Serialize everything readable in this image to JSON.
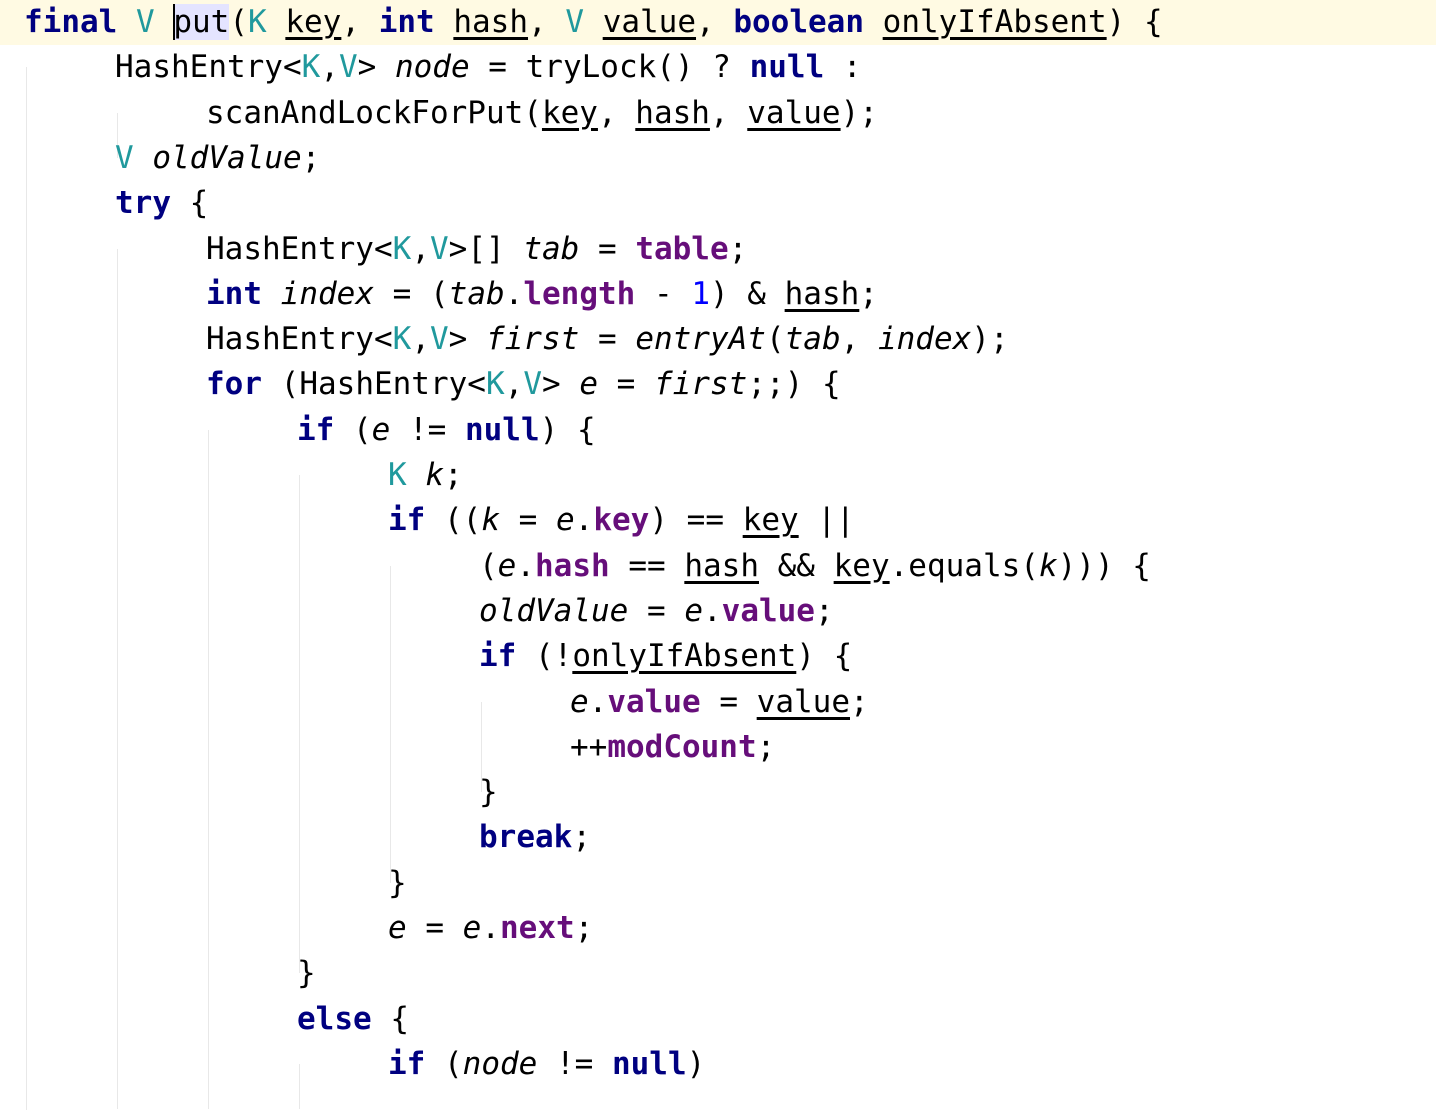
{
  "editor": {
    "language": "Java",
    "caret": {
      "line": 1,
      "before_token": "put"
    },
    "highlighted_identifier": "put",
    "lines": [
      {
        "n": 1,
        "indent": 0,
        "current": true,
        "tokens": [
          {
            "t": "final",
            "s": "kw"
          },
          {
            "t": " ",
            "s": "pl"
          },
          {
            "t": "V",
            "s": "tp"
          },
          {
            "t": " ",
            "s": "pl"
          },
          {
            "t": "put",
            "s": "fn",
            "hl": true,
            "caret": true
          },
          {
            "t": "(",
            "s": "pl"
          },
          {
            "t": "K",
            "s": "tp"
          },
          {
            "t": " ",
            "s": "pl"
          },
          {
            "t": "key",
            "s": "prm"
          },
          {
            "t": ", ",
            "s": "pl"
          },
          {
            "t": "int",
            "s": "kw"
          },
          {
            "t": " ",
            "s": "pl"
          },
          {
            "t": "hash",
            "s": "prm"
          },
          {
            "t": ", ",
            "s": "pl"
          },
          {
            "t": "V",
            "s": "tp"
          },
          {
            "t": " ",
            "s": "pl"
          },
          {
            "t": "value",
            "s": "prm"
          },
          {
            "t": ", ",
            "s": "pl"
          },
          {
            "t": "boolean",
            "s": "kw"
          },
          {
            "t": " ",
            "s": "pl"
          },
          {
            "t": "onlyIfAbsent",
            "s": "prm"
          },
          {
            "t": ") {",
            "s": "pl"
          }
        ]
      },
      {
        "n": 2,
        "indent": 1,
        "tokens": [
          {
            "t": "HashEntry<",
            "s": "pl"
          },
          {
            "t": "K",
            "s": "tp"
          },
          {
            "t": ",",
            "s": "pl"
          },
          {
            "t": "V",
            "s": "tp"
          },
          {
            "t": "> ",
            "s": "pl"
          },
          {
            "t": "node",
            "s": "loc"
          },
          {
            "t": " = tryLock() ? ",
            "s": "pl"
          },
          {
            "t": "null",
            "s": "kw"
          },
          {
            "t": " :",
            "s": "pl"
          }
        ]
      },
      {
        "n": 3,
        "indent": 2,
        "tokens": [
          {
            "t": "scanAndLockForPut(",
            "s": "pl"
          },
          {
            "t": "key",
            "s": "prm"
          },
          {
            "t": ", ",
            "s": "pl"
          },
          {
            "t": "hash",
            "s": "prm"
          },
          {
            "t": ", ",
            "s": "pl"
          },
          {
            "t": "value",
            "s": "prm"
          },
          {
            "t": ");",
            "s": "pl"
          }
        ]
      },
      {
        "n": 4,
        "indent": 1,
        "tokens": [
          {
            "t": "V",
            "s": "tp"
          },
          {
            "t": " ",
            "s": "pl"
          },
          {
            "t": "oldValue",
            "s": "loc"
          },
          {
            "t": ";",
            "s": "pl"
          }
        ]
      },
      {
        "n": 5,
        "indent": 1,
        "tokens": [
          {
            "t": "try",
            "s": "kw"
          },
          {
            "t": " {",
            "s": "pl"
          }
        ]
      },
      {
        "n": 6,
        "indent": 2,
        "tokens": [
          {
            "t": "HashEntry<",
            "s": "pl"
          },
          {
            "t": "K",
            "s": "tp"
          },
          {
            "t": ",",
            "s": "pl"
          },
          {
            "t": "V",
            "s": "tp"
          },
          {
            "t": ">[] ",
            "s": "pl"
          },
          {
            "t": "tab",
            "s": "loc"
          },
          {
            "t": " = ",
            "s": "pl"
          },
          {
            "t": "table",
            "s": "fld"
          },
          {
            "t": ";",
            "s": "pl"
          }
        ]
      },
      {
        "n": 7,
        "indent": 2,
        "tokens": [
          {
            "t": "int",
            "s": "kw"
          },
          {
            "t": " ",
            "s": "pl"
          },
          {
            "t": "index",
            "s": "loc"
          },
          {
            "t": " = (",
            "s": "pl"
          },
          {
            "t": "tab",
            "s": "loc"
          },
          {
            "t": ".",
            "s": "pl"
          },
          {
            "t": "length",
            "s": "fld"
          },
          {
            "t": " - ",
            "s": "pl"
          },
          {
            "t": "1",
            "s": "num"
          },
          {
            "t": ") & ",
            "s": "pl"
          },
          {
            "t": "hash",
            "s": "prm"
          },
          {
            "t": ";",
            "s": "pl"
          }
        ]
      },
      {
        "n": 8,
        "indent": 2,
        "tokens": [
          {
            "t": "HashEntry<",
            "s": "pl"
          },
          {
            "t": "K",
            "s": "tp"
          },
          {
            "t": ",",
            "s": "pl"
          },
          {
            "t": "V",
            "s": "tp"
          },
          {
            "t": "> ",
            "s": "pl"
          },
          {
            "t": "first",
            "s": "loc"
          },
          {
            "t": " = ",
            "s": "pl"
          },
          {
            "t": "entryAt",
            "s": "sfn"
          },
          {
            "t": "(",
            "s": "pl"
          },
          {
            "t": "tab",
            "s": "loc"
          },
          {
            "t": ", ",
            "s": "pl"
          },
          {
            "t": "index",
            "s": "loc"
          },
          {
            "t": ");",
            "s": "pl"
          }
        ]
      },
      {
        "n": 9,
        "indent": 2,
        "tokens": [
          {
            "t": "for",
            "s": "kw"
          },
          {
            "t": " (HashEntry<",
            "s": "pl"
          },
          {
            "t": "K",
            "s": "tp"
          },
          {
            "t": ",",
            "s": "pl"
          },
          {
            "t": "V",
            "s": "tp"
          },
          {
            "t": "> ",
            "s": "pl"
          },
          {
            "t": "e",
            "s": "loc"
          },
          {
            "t": " = ",
            "s": "pl"
          },
          {
            "t": "first",
            "s": "loc"
          },
          {
            "t": ";;) {",
            "s": "pl"
          }
        ]
      },
      {
        "n": 10,
        "indent": 3,
        "tokens": [
          {
            "t": "if",
            "s": "kw"
          },
          {
            "t": " (",
            "s": "pl"
          },
          {
            "t": "e",
            "s": "loc"
          },
          {
            "t": " != ",
            "s": "pl"
          },
          {
            "t": "null",
            "s": "kw"
          },
          {
            "t": ") {",
            "s": "pl"
          }
        ]
      },
      {
        "n": 11,
        "indent": 4,
        "tokens": [
          {
            "t": "K",
            "s": "tp"
          },
          {
            "t": " ",
            "s": "pl"
          },
          {
            "t": "k",
            "s": "loc"
          },
          {
            "t": ";",
            "s": "pl"
          }
        ]
      },
      {
        "n": 12,
        "indent": 4,
        "tokens": [
          {
            "t": "if",
            "s": "kw"
          },
          {
            "t": " ((",
            "s": "pl"
          },
          {
            "t": "k",
            "s": "loc"
          },
          {
            "t": " = ",
            "s": "pl"
          },
          {
            "t": "e",
            "s": "loc"
          },
          {
            "t": ".",
            "s": "pl"
          },
          {
            "t": "key",
            "s": "fld"
          },
          {
            "t": ") == ",
            "s": "pl"
          },
          {
            "t": "key",
            "s": "prm"
          },
          {
            "t": " ||",
            "s": "pl"
          }
        ]
      },
      {
        "n": 13,
        "indent": 5,
        "tokens": [
          {
            "t": "(",
            "s": "pl"
          },
          {
            "t": "e",
            "s": "loc"
          },
          {
            "t": ".",
            "s": "pl"
          },
          {
            "t": "hash",
            "s": "fld"
          },
          {
            "t": " == ",
            "s": "pl"
          },
          {
            "t": "hash",
            "s": "prm"
          },
          {
            "t": " && ",
            "s": "pl"
          },
          {
            "t": "key",
            "s": "prm"
          },
          {
            "t": ".equals(",
            "s": "pl"
          },
          {
            "t": "k",
            "s": "loc"
          },
          {
            "t": "))) {",
            "s": "pl"
          }
        ]
      },
      {
        "n": 14,
        "indent": 5,
        "tokens": [
          {
            "t": "oldValue",
            "s": "loc"
          },
          {
            "t": " = ",
            "s": "pl"
          },
          {
            "t": "e",
            "s": "loc"
          },
          {
            "t": ".",
            "s": "pl"
          },
          {
            "t": "value",
            "s": "fld"
          },
          {
            "t": ";",
            "s": "pl"
          }
        ]
      },
      {
        "n": 15,
        "indent": 5,
        "tokens": [
          {
            "t": "if",
            "s": "kw"
          },
          {
            "t": " (!",
            "s": "pl"
          },
          {
            "t": "onlyIfAbsent",
            "s": "prm"
          },
          {
            "t": ") {",
            "s": "pl"
          }
        ]
      },
      {
        "n": 16,
        "indent": 6,
        "tokens": [
          {
            "t": "e",
            "s": "loc"
          },
          {
            "t": ".",
            "s": "pl"
          },
          {
            "t": "value",
            "s": "fld"
          },
          {
            "t": " = ",
            "s": "pl"
          },
          {
            "t": "value",
            "s": "prm"
          },
          {
            "t": ";",
            "s": "pl"
          }
        ]
      },
      {
        "n": 17,
        "indent": 6,
        "tokens": [
          {
            "t": "++",
            "s": "pl"
          },
          {
            "t": "modCount",
            "s": "fld"
          },
          {
            "t": ";",
            "s": "pl"
          }
        ]
      },
      {
        "n": 18,
        "indent": 5,
        "tokens": [
          {
            "t": "}",
            "s": "pl"
          }
        ]
      },
      {
        "n": 19,
        "indent": 5,
        "tokens": [
          {
            "t": "break",
            "s": "kw"
          },
          {
            "t": ";",
            "s": "pl"
          }
        ]
      },
      {
        "n": 20,
        "indent": 4,
        "tokens": [
          {
            "t": "}",
            "s": "pl"
          }
        ]
      },
      {
        "n": 21,
        "indent": 4,
        "tokens": [
          {
            "t": "e",
            "s": "loc"
          },
          {
            "t": " = ",
            "s": "pl"
          },
          {
            "t": "e",
            "s": "loc"
          },
          {
            "t": ".",
            "s": "pl"
          },
          {
            "t": "next",
            "s": "fld"
          },
          {
            "t": ";",
            "s": "pl"
          }
        ]
      },
      {
        "n": 22,
        "indent": 3,
        "tokens": [
          {
            "t": "}",
            "s": "pl"
          }
        ]
      },
      {
        "n": 23,
        "indent": 3,
        "tokens": [
          {
            "t": "else",
            "s": "kw"
          },
          {
            "t": " {",
            "s": "pl"
          }
        ]
      },
      {
        "n": 24,
        "indent": 4,
        "tokens": [
          {
            "t": "if",
            "s": "kw"
          },
          {
            "t": " (",
            "s": "pl"
          },
          {
            "t": "node",
            "s": "loc"
          },
          {
            "t": " != ",
            "s": "pl"
          },
          {
            "t": "null",
            "s": "kw"
          },
          {
            "t": ")",
            "s": "pl"
          }
        ]
      }
    ]
  },
  "theme": {
    "keyword": "#000080",
    "type_param": "#20999d",
    "field": "#660e7a",
    "number": "#0000ff",
    "current_line": "#fffae3",
    "identifier_highlight": "#e4e4ff",
    "indent_guide": "#e8e8e8"
  }
}
